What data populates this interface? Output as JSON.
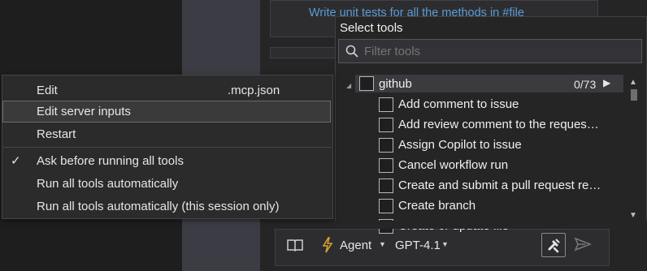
{
  "suggestion": {
    "text": "Write unit tests for all the methods in #file"
  },
  "tools_panel": {
    "title": "Select tools",
    "filter_placeholder": "Filter tools",
    "group": {
      "name": "github",
      "count": "0/73"
    },
    "tools": [
      "Add comment to issue",
      "Add review comment to the reques…",
      "Assign Copilot to issue",
      "Cancel workflow run",
      "Create and submit a pull request re…",
      "Create branch",
      "Create or update file"
    ]
  },
  "context_menu": {
    "items": [
      {
        "label": "Edit",
        "shortcut": ".mcp.json",
        "checked": false
      },
      {
        "label": "Edit server inputs",
        "checked": false,
        "highlighted": true
      },
      {
        "label": "Restart",
        "checked": false
      },
      {
        "label": "Ask before running all tools",
        "checked": true
      },
      {
        "label": "Run all tools automatically",
        "checked": false
      },
      {
        "label": "Run all tools automatically (this session only)",
        "checked": false
      }
    ],
    "check_glyph": "✓"
  },
  "toolbar": {
    "mode_label": "Agent",
    "model_label": "GPT-4.1"
  },
  "colors": {
    "link": "#5b9bd5",
    "accent_bolt": "#d7a12b",
    "panel_bg": "#252526",
    "menu_bg": "#2b2b2b"
  },
  "icons": [
    "book-icon",
    "bolt-icon",
    "tools-icon",
    "send-icon",
    "search-icon",
    "chevron-down-icon",
    "play-icon"
  ]
}
